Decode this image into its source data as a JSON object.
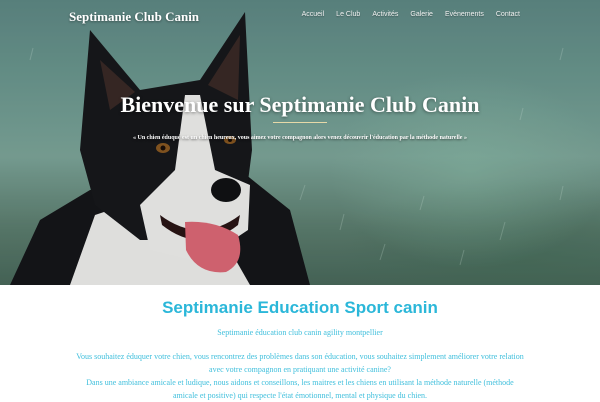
{
  "header": {
    "site_title": "Septimanie Club Canin",
    "nav": [
      {
        "label": "Accueil"
      },
      {
        "label": "Le Club"
      },
      {
        "label": "Activités"
      },
      {
        "label": "Galerie"
      },
      {
        "label": "Evènements"
      },
      {
        "label": "Contact"
      }
    ]
  },
  "hero": {
    "heading": "Bienvenue sur Septimanie Club Canin",
    "quote": "« Un chien éduqué est un chien heureux, vous aimez votre compagnon alors venez découvrir l'éducation par la méthode naturelle »"
  },
  "intro": {
    "title": "Septimanie Education Sport canin",
    "subtitle": "Septimanie éducation club canin agility montpellier",
    "paragraph_1a": "Vous souhaitez éduquer votre chien, vous rencontrez des problèmes dans son éducation, vous souhaitez simplement améliorer votre relation",
    "paragraph_1b": "avec votre compagnon en pratiquant une activité canine?",
    "paragraph_2a": "Dans une ambiance amicale et ludique, nous aidons et conseillons, les maitres et les chiens en utilisant la méthode naturelle (méthode",
    "paragraph_2b": "amicale et positive) qui respecte l'état émotionnel, mental et physique du chien."
  },
  "colors": {
    "accent": "#2bb7d9",
    "rule": "#e6d9a8"
  }
}
